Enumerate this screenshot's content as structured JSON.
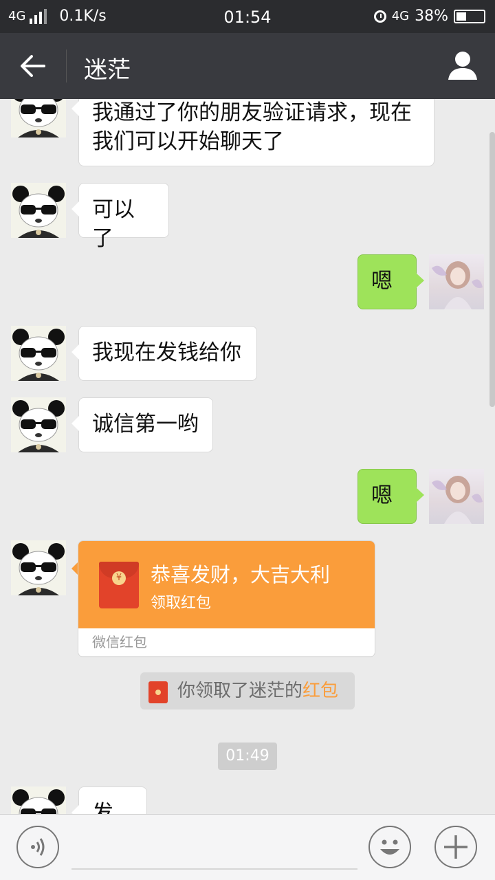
{
  "status_bar": {
    "network_left": "4G",
    "speed": "0.1K/s",
    "time": "01:54",
    "network_right": "4G",
    "battery": "38%",
    "battery_level": 0.38
  },
  "header": {
    "title": "迷茫",
    "back_icon": "arrow-left-icon",
    "profile_icon": "person-icon"
  },
  "messages": [
    {
      "side": "left",
      "avatar": "panda",
      "text_line1": "我通过了你的朋友验证请求，现在",
      "text_line2": "我们可以开始聊天了"
    },
    {
      "side": "left",
      "avatar": "panda",
      "text": "可以了"
    },
    {
      "side": "right",
      "avatar": "girl",
      "text": "嗯"
    },
    {
      "side": "left",
      "avatar": "panda",
      "text": "我现在发钱给你"
    },
    {
      "side": "left",
      "avatar": "panda",
      "text": "诚信第一哟"
    },
    {
      "side": "right",
      "avatar": "girl",
      "text": "嗯"
    },
    {
      "side": "left",
      "avatar": "panda",
      "red_packet": {
        "title": "恭喜发财，大吉大利",
        "subtitle": "领取红包",
        "footer": "微信红包",
        "coin_symbol": "¥"
      }
    },
    {
      "side": "left",
      "avatar": "panda",
      "text": "发了"
    }
  ],
  "system_message": {
    "prefix": "你领取了迷茫的",
    "highlight": "红包"
  },
  "timestamp": "01:49",
  "colors": {
    "title_bar": "#393a3f",
    "status_bar": "#2b2c2f",
    "my_bubble": "#9ee35a",
    "red_packet": "#fa9d3b",
    "background": "#ebebeb"
  }
}
